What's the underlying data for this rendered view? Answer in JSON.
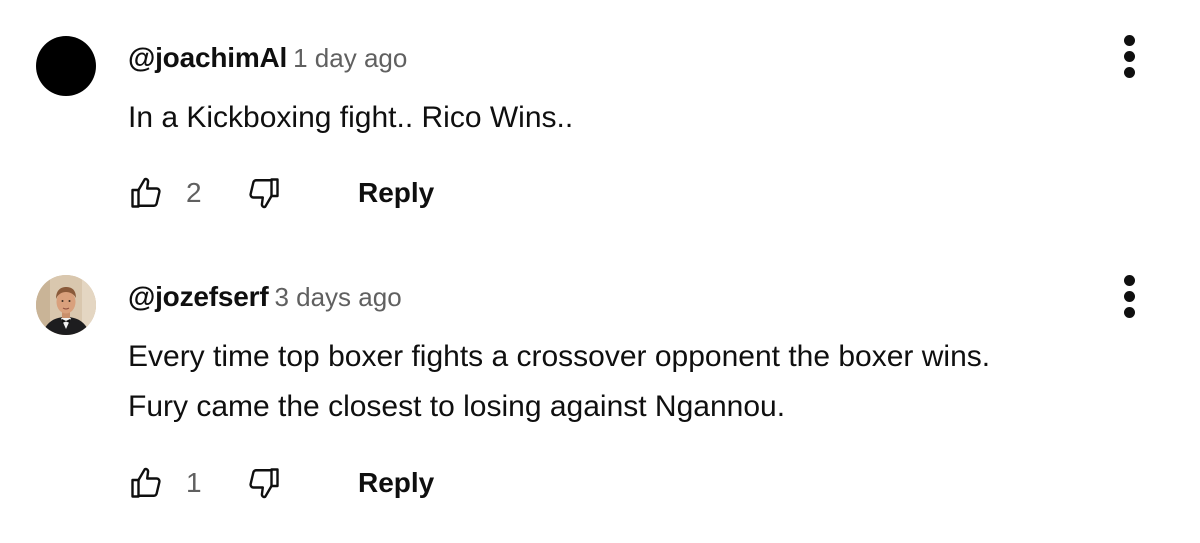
{
  "comments": [
    {
      "author": "@joachimAl",
      "time": "1 day ago",
      "text_lines": [
        "In a Kickboxing fight.. Rico Wins.."
      ],
      "likes": "2",
      "reply_label": "Reply",
      "avatar": "black-circle-avatar",
      "avatar_color": "#000000"
    },
    {
      "author": "@jozefserf",
      "time": "3 days ago",
      "text_lines": [
        "Every time top boxer fights a crossover opponent the boxer wins.",
        "Fury came the closest to losing against Ngannou."
      ],
      "likes": "1",
      "reply_label": "Reply",
      "avatar": "photo-avatar-man-in-tuxedo"
    }
  ],
  "icons": {
    "like": "thumbs-up-icon",
    "dislike": "thumbs-down-icon",
    "menu": "more-vertical-icon"
  },
  "colors": {
    "text": "#0f0f0f",
    "secondary_text": "#606060",
    "background": "#ffffff"
  }
}
